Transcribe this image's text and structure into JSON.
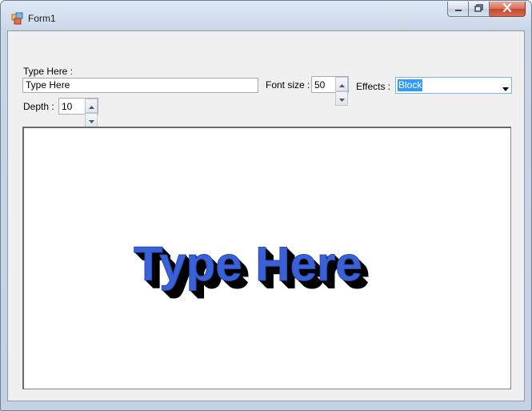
{
  "window": {
    "title": "Form1",
    "icons": {
      "app": "app-form-icon",
      "minimize": "minimize-icon",
      "maximize": "maximize-icon",
      "close": "close-icon"
    }
  },
  "form": {
    "text_label": "Type Here :",
    "text_value": "Type Here",
    "font_size_label": "Font size :",
    "font_size_value": "50",
    "effects_label": "Effects :",
    "effects_value": "Block",
    "depth_label": "Depth :",
    "depth_value": "10"
  },
  "preview": {
    "text": "Type Here",
    "fill_color": "#3a61d6",
    "shadow_color": "#000000",
    "icons": {
      "spin_up": "spin-up-icon",
      "spin_down": "spin-down-icon",
      "dropdown": "dropdown-arrow-icon"
    }
  }
}
